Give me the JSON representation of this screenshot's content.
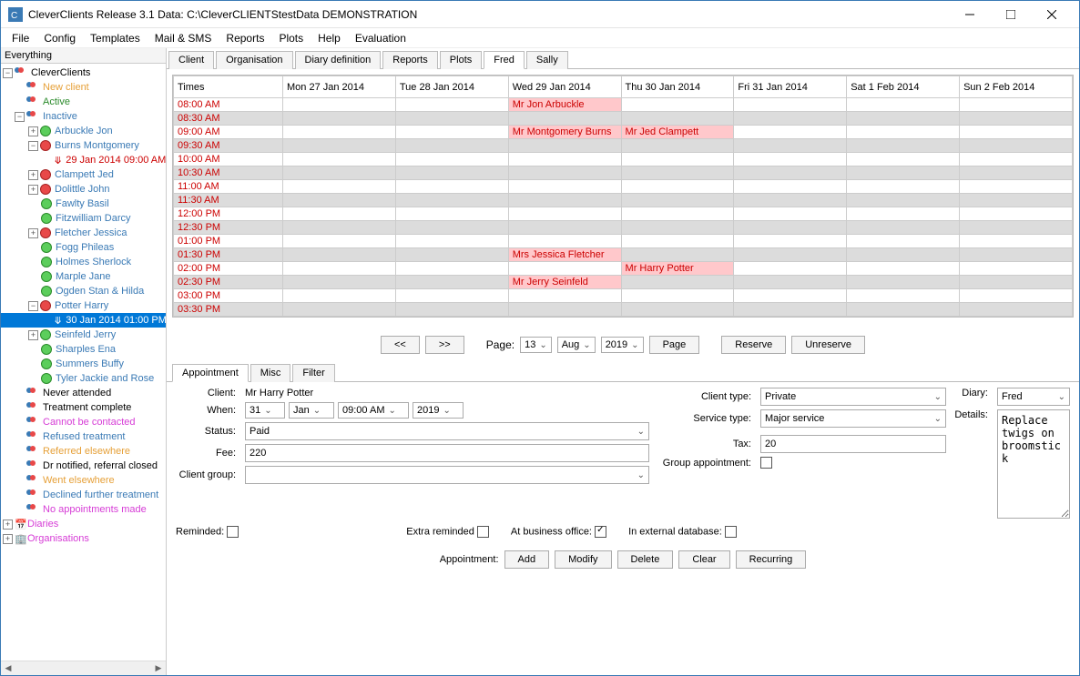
{
  "window": {
    "title": "CleverClients Release 3.1 Data: C:\\CleverCLIENTStestData DEMONSTRATION"
  },
  "menubar": [
    "File",
    "Config",
    "Templates",
    "Mail & SMS",
    "Reports",
    "Plots",
    "Help",
    "Evaluation"
  ],
  "sidebar": {
    "header": "Everything",
    "root": "CleverClients",
    "new_client": "New client",
    "active": "Active",
    "inactive": "Inactive",
    "clients": {
      "arbuckle": "Arbuckle Jon",
      "burns": "Burns Montgomery",
      "burns_appt": "29 Jan 2014 09:00 AM",
      "clampett": "Clampett Jed",
      "dolittle": "Dolittle John",
      "fawlty": "Fawlty Basil",
      "fitzwilliam": "Fitzwilliam Darcy",
      "fletcher": "Fletcher Jessica",
      "fogg": "Fogg Phileas",
      "holmes": "Holmes Sherlock",
      "marple": "Marple Jane",
      "ogden": "Ogden Stan & Hilda",
      "potter": "Potter Harry",
      "potter_appt": "30 Jan 2014 01:00 PM",
      "seinfeld": "Seinfeld Jerry",
      "sharples": "Sharples Ena",
      "summers": "Summers Buffy",
      "tyler": "Tyler Jackie and Rose"
    },
    "categories": {
      "never": "Never attended",
      "complete": "Treatment complete",
      "cannot": "Cannot be contacted",
      "refused": "Refused treatment",
      "referred": "Referred elsewhere",
      "notified": "Dr notified, referral closed",
      "went": "Went elsewhere",
      "declined": "Declined further treatment",
      "noappt": "No appointments made"
    },
    "diaries": "Diaries",
    "organisations": "Organisations"
  },
  "main_tabs": [
    "Client",
    "Organisation",
    "Diary definition",
    "Reports",
    "Plots",
    "Fred",
    "Sally"
  ],
  "main_tab_active": "Fred",
  "diary": {
    "times_hdr": "Times",
    "days": [
      "Mon 27 Jan 2014",
      "Tue 28 Jan 2014",
      "Wed 29 Jan 2014",
      "Thu 30 Jan 2014",
      "Fri 31 Jan 2014",
      "Sat 1 Feb 2014",
      "Sun 2 Feb 2014"
    ],
    "times": [
      "08:00 AM",
      "08:30 AM",
      "09:00 AM",
      "09:30 AM",
      "10:00 AM",
      "10:30 AM",
      "11:00 AM",
      "11:30 AM",
      "12:00 PM",
      "12:30 PM",
      "01:00 PM",
      "01:30 PM",
      "02:00 PM",
      "02:30 PM",
      "03:00 PM",
      "03:30 PM"
    ],
    "appts": {
      "arbuckle": "Mr Jon Arbuckle",
      "burns": "Mr Montgomery Burns",
      "clampett": "Mr Jed Clampett",
      "fletcher": "Mrs Jessica Fletcher",
      "potter": "Mr Harry Potter",
      "seinfeld": "Mr Jerry Seinfeld"
    }
  },
  "pager": {
    "prev": "<<",
    "next": ">>",
    "page_lbl": "Page:",
    "page_num": "13",
    "month": "Aug",
    "year": "2019",
    "page_btn": "Page",
    "reserve": "Reserve",
    "unreserve": "Unreserve"
  },
  "bottom_tabs": [
    "Appointment",
    "Misc",
    "Filter"
  ],
  "bottom_tab_active": "Appointment",
  "form": {
    "client_lbl": "Client:",
    "client_val": "Mr Harry Potter",
    "when_lbl": "When:",
    "when_day": "31",
    "when_month": "Jan",
    "when_time": "09:00 AM",
    "when_year": "2019",
    "status_lbl": "Status:",
    "status_val": "Paid",
    "fee_lbl": "Fee:",
    "fee_val": "220",
    "group_lbl": "Client group:",
    "group_val": "",
    "ctype_lbl": "Client type:",
    "ctype_val": "Private",
    "stype_lbl": "Service type:",
    "stype_val": "Major service",
    "tax_lbl": "Tax:",
    "tax_val": "20",
    "gappt_lbl": "Group appointment:",
    "diary_lbl": "Diary:",
    "diary_val": "Fred",
    "details_lbl": "Details:",
    "details_val": "Replace twigs on broomstick",
    "reminded": "Reminded:",
    "extra": "Extra reminded",
    "office": "At business office:",
    "external": "In external database:",
    "appt_lbl": "Appointment:",
    "add": "Add",
    "modify": "Modify",
    "delete": "Delete",
    "clear": "Clear",
    "recurring": "Recurring"
  }
}
